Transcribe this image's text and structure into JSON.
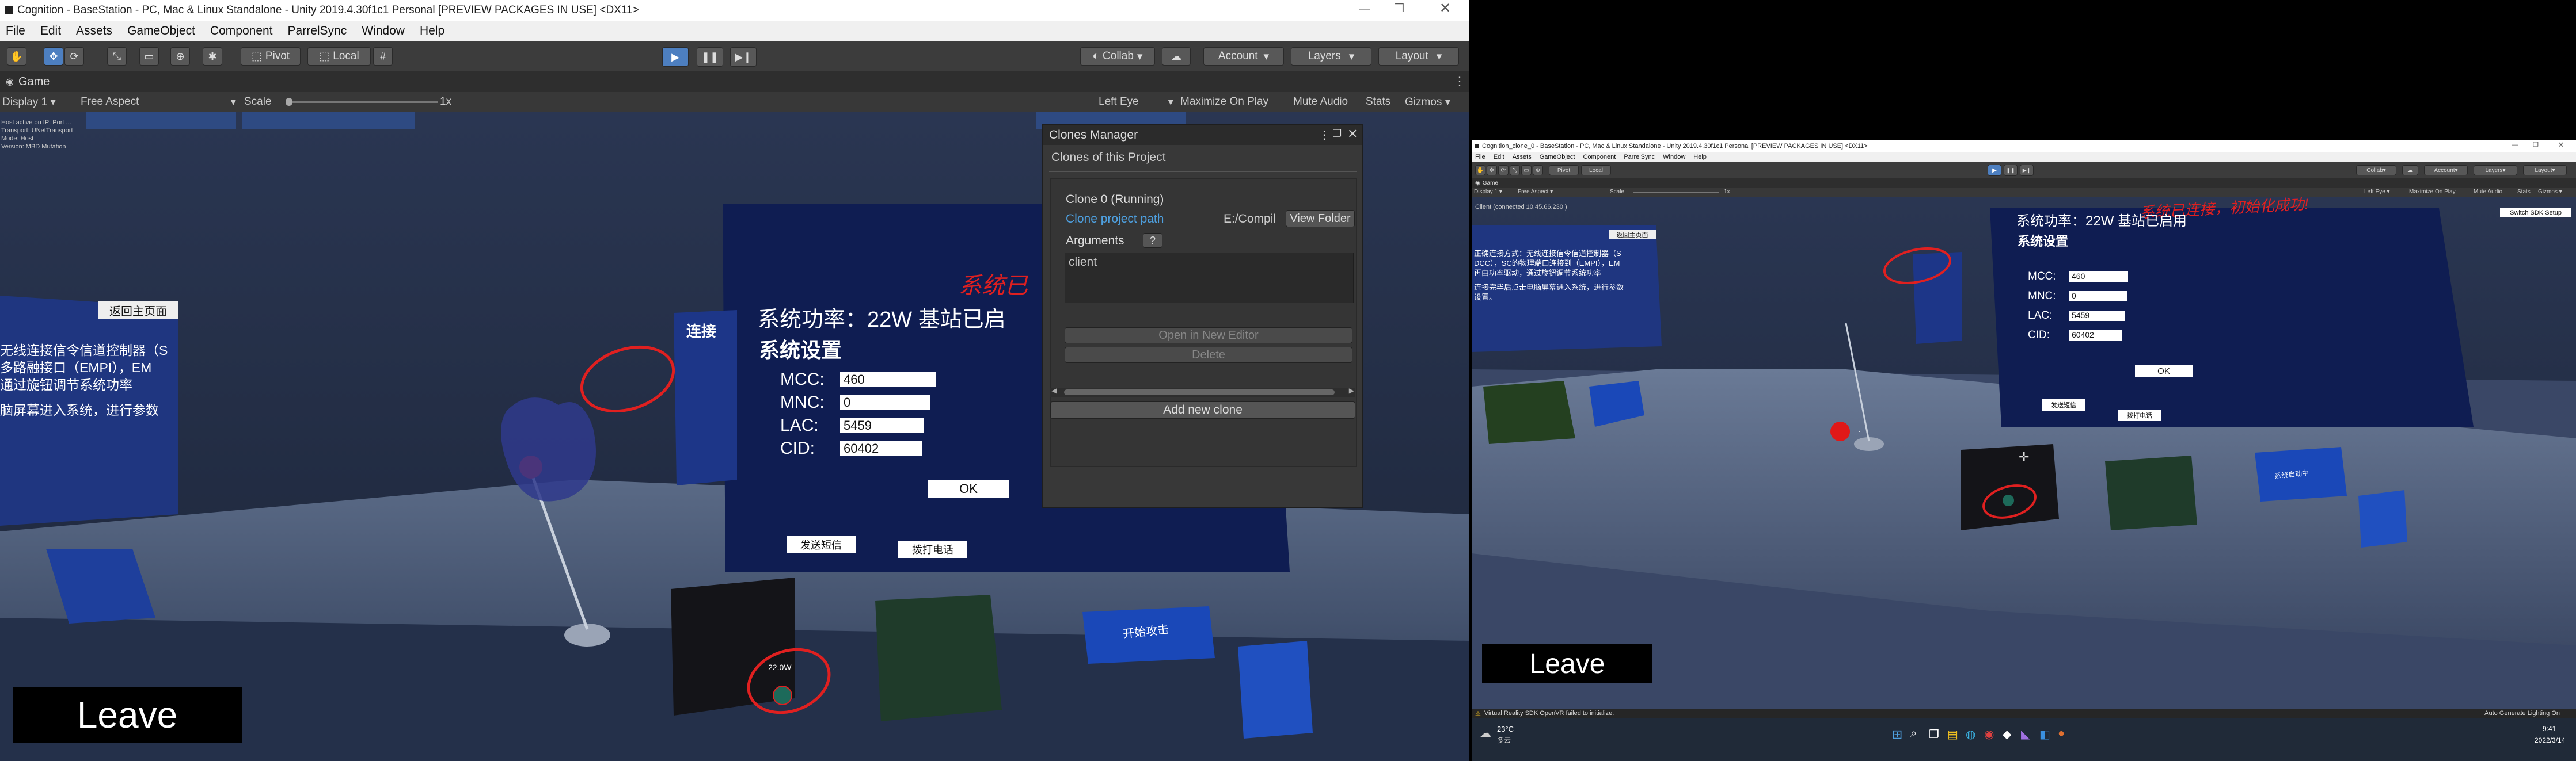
{
  "left": {
    "window_title": "Cognition - BaseStation - PC, Mac & Linux Standalone - Unity 2019.4.30f1c1 Personal [PREVIEW PACKAGES IN USE] <DX11>",
    "menu": [
      "File",
      "Edit",
      "Assets",
      "GameObject",
      "Component",
      "ParrelSync",
      "Window",
      "Help"
    ],
    "toolbar": {
      "pivot": "Pivot",
      "local": "Local",
      "collab": "Collab",
      "account": "Account",
      "layers": "Layers",
      "layout": "Layout"
    },
    "game_tab": "Game",
    "gamebar": {
      "display": "Display 1",
      "aspect": "Free Aspect",
      "scale_label": "Scale",
      "scale_value": "1x",
      "eye": "Left Eye",
      "maximize": "Maximize On Play",
      "mute": "Mute Audio",
      "stats": "Stats",
      "gizmos": "Gizmos"
    },
    "scene": {
      "debug_lines": [
        "Host active on IP: Port ...",
        "Transport: UNetTransport",
        "Mode: Host",
        "Version: MBD Mutation"
      ],
      "back_button": "返回主页面",
      "left_panel_lines": [
        "无线连接信令信道控制器（S",
        "多路融接口（EMPI），EM",
        "通过旋钮调节系统功率",
        "",
        "脑屏幕进入系统，进行参数"
      ],
      "connect_label": "连接",
      "banner_red": "系统已",
      "power": "系统功率：22W  基站已启",
      "settings": "系统设置",
      "fields": [
        {
          "label": "MCC:",
          "value": "460"
        },
        {
          "label": "MNC:",
          "value": "0"
        },
        {
          "label": "LAC:",
          "value": "5459"
        },
        {
          "label": "CID:",
          "value": "60402"
        }
      ],
      "ok": "OK",
      "btn_a": "发送短信",
      "btn_b": "拨打电话",
      "device_reading": "22.0W",
      "laptop_screen": "开始攻击",
      "leave": "Leave"
    }
  },
  "clones_manager": {
    "title": "Clones Manager",
    "subtitle": "Clones of this Project",
    "clone_name": "Clone 0 (Running)",
    "path_label": "Clone project path",
    "path_value": "E:/Compil",
    "view_folder": "View Folder",
    "arguments_label": "Arguments",
    "help": "?",
    "arguments_value": "client",
    "open_editor": "Open in New Editor",
    "delete": "Delete",
    "add_clone": "Add new clone"
  },
  "right": {
    "window_title": "Cognition_clone_0 - BaseStation - PC, Mac & Linux Standalone - Unity 2019.4.30f1c1 Personal [PREVIEW PACKAGES IN USE] <DX11>",
    "menu": [
      "File",
      "Edit",
      "Assets",
      "GameObject",
      "Component",
      "ParrelSync",
      "Window",
      "Help"
    ],
    "toolbar": {
      "pivot": "Pivot",
      "local": "Local",
      "collab": "Collab",
      "account": "Account",
      "layers": "Layers",
      "layout": "Layout"
    },
    "game_tab": "Game",
    "gamebar": {
      "display": "Display 1",
      "aspect": "Free Aspect",
      "scale_label": "Scale",
      "scale_value": "1x",
      "eye": "Left Eye",
      "maximize": "Maximize On Play",
      "mute": "Mute Audio",
      "stats": "Stats",
      "gizmos": "Gizmos"
    },
    "sdk": "Switch SDK Setup",
    "scene": {
      "client_line": "Client (connected 10.45.66.230 )",
      "back_button": "返回主页面",
      "left_panel_lines": [
        "正确连接方式：无线连接信令信道控制器（S",
        "DCC），SC的物理端口连接到（EMPI），EM",
        "再由功率驱动，通过旋钮调节系统功率",
        "",
        "连接完毕后点击电脑屏幕进入系统，进行参数",
        "设置。"
      ],
      "banner_red": "系统已连接，初始化成功!",
      "power": "系统功率：22W  基站已启用",
      "settings": "系统设置",
      "fields": [
        {
          "label": "MCC:",
          "value": "460"
        },
        {
          "label": "MNC:",
          "value": "0"
        },
        {
          "label": "LAC:",
          "value": "5459"
        },
        {
          "label": "CID:",
          "value": "60402"
        }
      ],
      "ok": "OK",
      "btn_a": "发送短信",
      "btn_b": "拨打电话",
      "laptop_screen": "系统启动中",
      "leave": "Leave"
    },
    "status_bar": "Virtual Reality SDK OpenVR failed to initialize.",
    "status_right": "Auto Generate Lighting On",
    "taskbar": {
      "weather_temp": "23°C",
      "weather_desc": "多云",
      "time": "9:41",
      "date": "2022/3/14"
    }
  },
  "colors": {
    "accent": "#4d7fc0",
    "highlight_red": "#e02020",
    "scene_dark": "#1e2a44",
    "panel_blue": "#1a2a66"
  }
}
